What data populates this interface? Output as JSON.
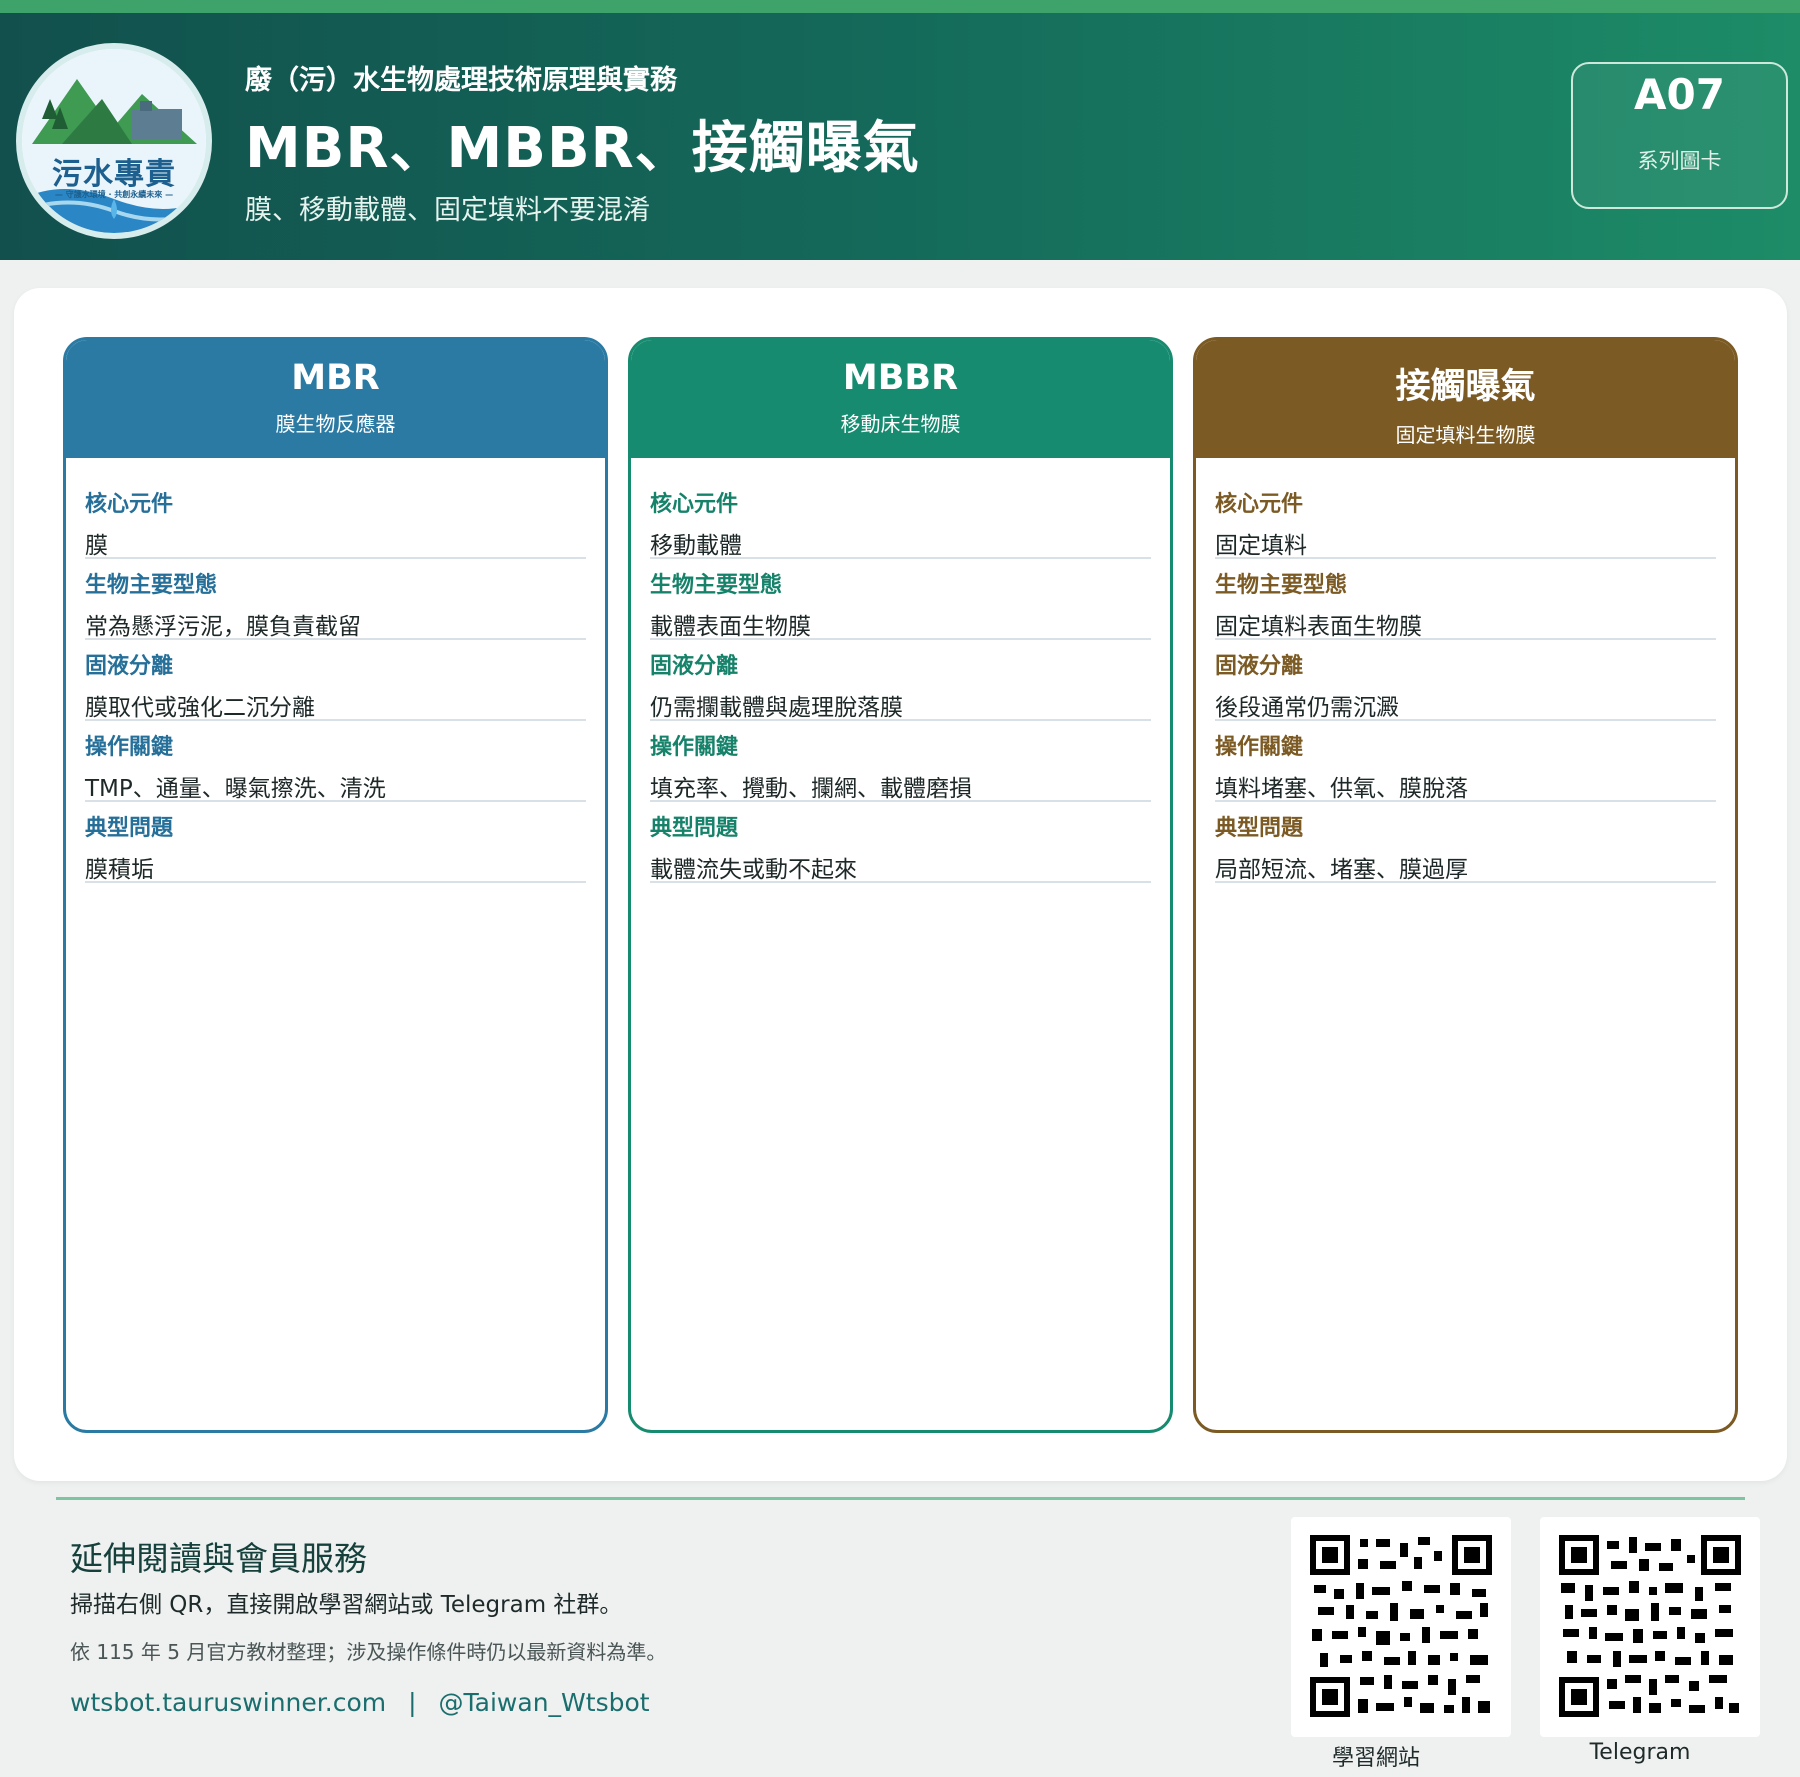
{
  "header": {
    "series": "廢（污）水生物處理技術原理與實務",
    "title": "MBR、MBBR、接觸曝氣",
    "subtitle": "膜、移動載體、固定填料不要混淆",
    "logo_text": "污水專責",
    "logo_tagline": "— 守護水環境 · 共創永續未來 —",
    "badge_code": "A07",
    "badge_label": "系列圖卡"
  },
  "cards": [
    {
      "title": "MBR",
      "subtitle": "膜生物反應器",
      "color": "#2a7aa3",
      "rows": [
        {
          "label": "核心元件",
          "value": "膜"
        },
        {
          "label": "生物主要型態",
          "value": "常為懸浮污泥，膜負責截留"
        },
        {
          "label": "固液分離",
          "value": "膜取代或強化二沉分離"
        },
        {
          "label": "操作關鍵",
          "value": "TMP、通量、曝氣擦洗、清洗"
        },
        {
          "label": "典型問題",
          "value": "膜積垢"
        }
      ]
    },
    {
      "title": "MBBR",
      "subtitle": "移動床生物膜",
      "color": "#178b70",
      "rows": [
        {
          "label": "核心元件",
          "value": "移動載體"
        },
        {
          "label": "生物主要型態",
          "value": "載體表面生物膜"
        },
        {
          "label": "固液分離",
          "value": "仍需攔載體與處理脫落膜"
        },
        {
          "label": "操作關鍵",
          "value": "填充率、攪動、攔網、載體磨損"
        },
        {
          "label": "典型問題",
          "value": "載體流失或動不起來"
        }
      ]
    },
    {
      "title": "接觸曝氣",
      "subtitle": "固定填料生物膜",
      "color": "#7b5a24",
      "rows": [
        {
          "label": "核心元件",
          "value": "固定填料"
        },
        {
          "label": "生物主要型態",
          "value": "固定填料表面生物膜"
        },
        {
          "label": "固液分離",
          "value": "後段通常仍需沉澱"
        },
        {
          "label": "操作關鍵",
          "value": "填料堵塞、供氧、膜脫落"
        },
        {
          "label": "典型問題",
          "value": "局部短流、堵塞、膜過厚"
        }
      ]
    }
  ],
  "footer": {
    "title": "延伸閱讀與會員服務",
    "description": "掃描右側 QR，直接開啟學習網站或 Telegram 社群。",
    "note": "依 115 年 5 月官方教材整理；涉及操作條件時仍以最新資料為準。",
    "website": "wtsbot.tauruswinner.com",
    "separator": "|",
    "telegram": "@Taiwan_Wtsbot",
    "qr_web_caption": "學習網站",
    "qr_tg_caption": "Telegram"
  }
}
